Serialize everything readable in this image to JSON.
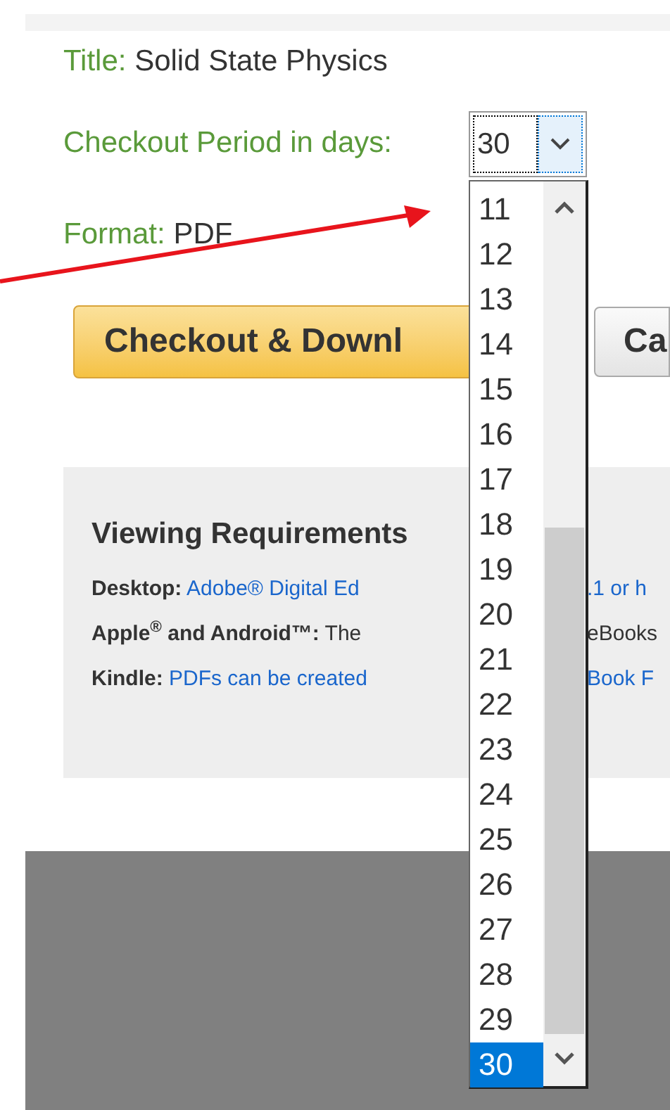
{
  "title": {
    "label": "Title:",
    "value": "Solid State Physics"
  },
  "checkout_period": {
    "label": "Checkout Period in days:",
    "value": "30"
  },
  "format": {
    "label": "Format:",
    "value": "PDF"
  },
  "buttons": [
    {
      "label": "Checkout & Downl",
      "kind": "primary"
    },
    {
      "label": "Ca",
      "kind": "secondary"
    }
  ],
  "viewing_requirements": {
    "heading": "Viewing Requirements",
    "lines": [
      {
        "label": "Desktop:",
        "link": "Adobe® Digital Ed",
        "tail_link": ".1 or h"
      },
      {
        "label": "Apple$^{®}$ and Android™:",
        "text": " The",
        "tail_text": "eBooks"
      },
      {
        "label": "Kindle:",
        "link": "PDFs can be created",
        "tail_link": "Book F"
      }
    ]
  },
  "dropdown": {
    "options": [
      {
        "label": "11",
        "selected": false
      },
      {
        "label": "12",
        "selected": false
      },
      {
        "label": "13",
        "selected": false
      },
      {
        "label": "14",
        "selected": false
      },
      {
        "label": "15",
        "selected": false
      },
      {
        "label": "16",
        "selected": false
      },
      {
        "label": "17",
        "selected": false
      },
      {
        "label": "18",
        "selected": false
      },
      {
        "label": "19",
        "selected": false
      },
      {
        "label": "20",
        "selected": false
      },
      {
        "label": "21",
        "selected": false
      },
      {
        "label": "22",
        "selected": false
      },
      {
        "label": "23",
        "selected": false
      },
      {
        "label": "24",
        "selected": false
      },
      {
        "label": "25",
        "selected": false
      },
      {
        "label": "26",
        "selected": false
      },
      {
        "label": "27",
        "selected": false
      },
      {
        "label": "28",
        "selected": false
      },
      {
        "label": "29",
        "selected": false
      },
      {
        "label": "30",
        "selected": true
      }
    ]
  }
}
